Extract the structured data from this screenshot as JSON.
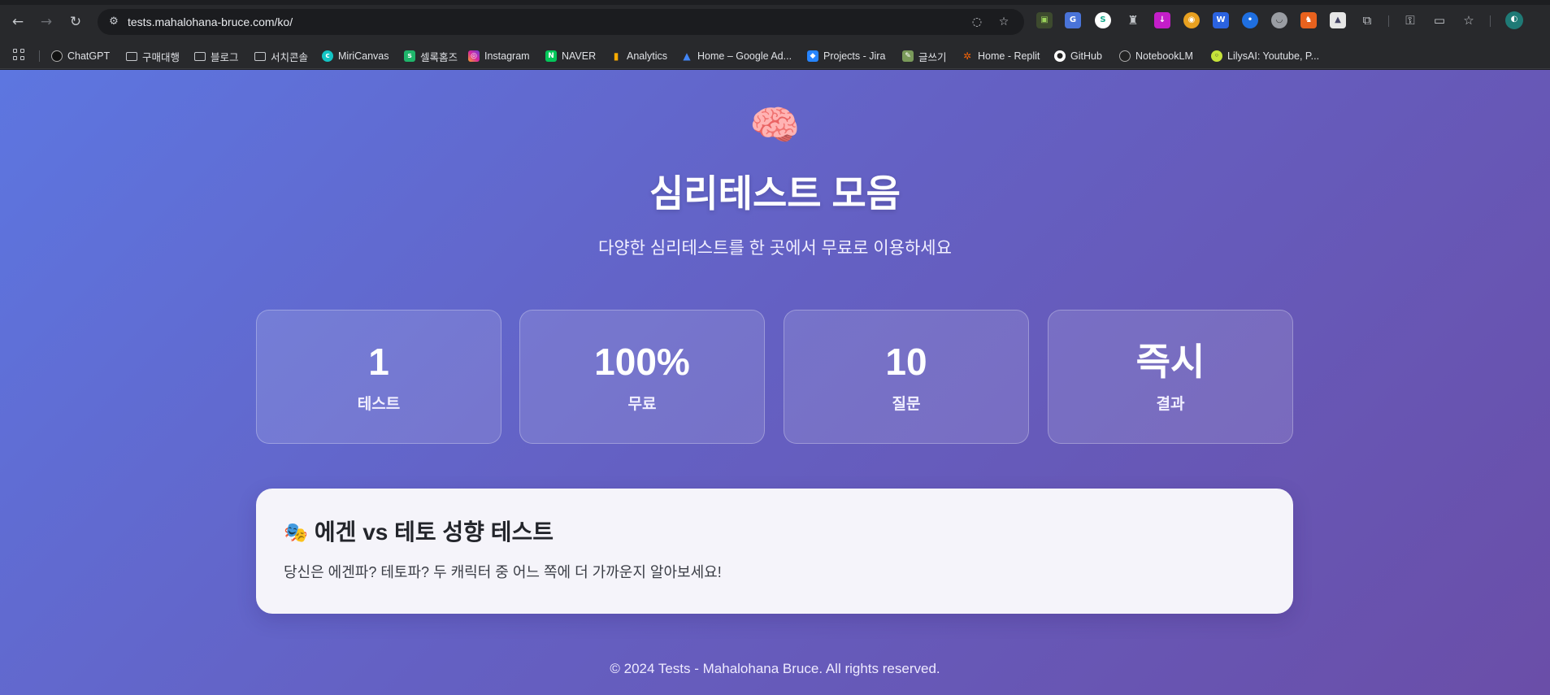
{
  "browser": {
    "url": "tests.mahalohana-bruce.com/ko/",
    "nav": {
      "back_icon": "←",
      "forward_icon": "→",
      "reload_icon": "↻"
    },
    "bookmarks": [
      {
        "label": "ChatGPT",
        "icon": "openai-icon",
        "color": "#111111"
      },
      {
        "label": "구매대행",
        "icon": "folder-icon"
      },
      {
        "label": "블로그",
        "icon": "folder-icon"
      },
      {
        "label": "서치콘솔",
        "icon": "folder-icon"
      },
      {
        "label": "MiriCanvas",
        "icon": "miricanvas-icon",
        "color": "#13c4c4"
      },
      {
        "label": "셀록홈즈",
        "icon": "sellock-icon",
        "color": "#1fb56b"
      },
      {
        "label": "Instagram",
        "icon": "instagram-icon",
        "color": "#d6249f"
      },
      {
        "label": "NAVER",
        "icon": "naver-icon",
        "color": "#03c75a"
      },
      {
        "label": "Analytics",
        "icon": "analytics-icon",
        "color": "#f9ab00"
      },
      {
        "label": "Home – Google Ad...",
        "icon": "google-ads-icon",
        "color": "#4285f4"
      },
      {
        "label": "Projects - Jira",
        "icon": "jira-icon",
        "color": "#2684ff"
      },
      {
        "label": "글쓰기",
        "icon": "write-icon",
        "color": "#7a9a5a"
      },
      {
        "label": "Home - Replit",
        "icon": "replit-icon",
        "color": "#f26207"
      },
      {
        "label": "GitHub",
        "icon": "github-icon",
        "color": "#ffffff"
      },
      {
        "label": "NotebookLM",
        "icon": "notebooklm-icon",
        "color": "#222222"
      },
      {
        "label": "LilysAI: Youtube, P...",
        "icon": "lilys-icon",
        "color": "#c6e33a"
      }
    ]
  },
  "hero": {
    "emoji": "🧠",
    "title": "심리테스트 모음",
    "subtitle": "다양한 심리테스트를 한 곳에서 무료로 이용하세요"
  },
  "stats": [
    {
      "value": "1",
      "label": "테스트"
    },
    {
      "value": "100%",
      "label": "무료"
    },
    {
      "value": "10",
      "label": "질문"
    },
    {
      "value": "즉시",
      "label": "결과"
    }
  ],
  "test_card": {
    "emoji": "🎭",
    "title": "에겐 vs 테토 성향 테스트",
    "description": "당신은 에겐파? 테토파? 두 캐릭터 중 어느 쪽에 더 가까운지 알아보세요!"
  },
  "footer": {
    "text": "© 2024 Tests - Mahalohana Bruce. All rights reserved."
  }
}
